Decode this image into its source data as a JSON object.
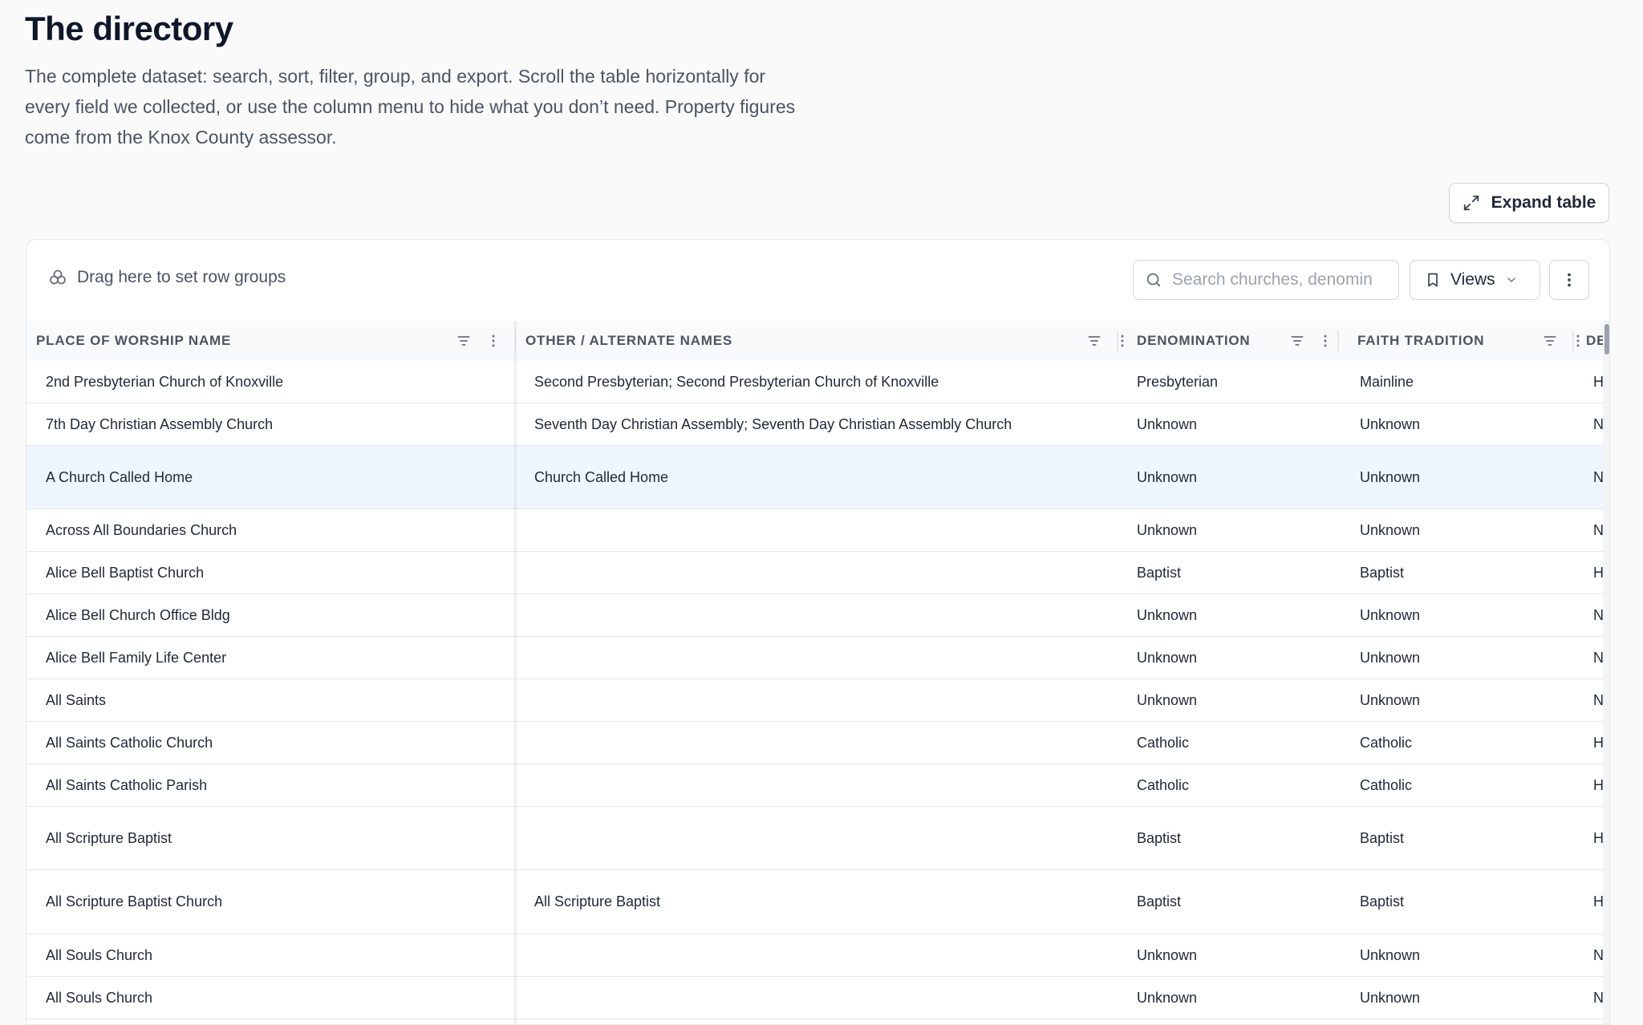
{
  "page": {
    "title": "The directory",
    "description": "The complete dataset: search, sort, filter, group, and export. Scroll the table horizontally for every field we collected, or use the column menu to hide what you don’t need. Property figures come from the Knox County assessor."
  },
  "actions": {
    "expand_label": "Expand table"
  },
  "toolbar": {
    "group_hint": "Drag here to set row groups",
    "search_placeholder": "Search churches, denominations…",
    "views_label": "Views"
  },
  "columns": [
    "PLACE OF WORSHIP NAME",
    "OTHER / ALTERNATE NAMES",
    "DENOMINATION",
    "FAITH TRADITION",
    "DE"
  ],
  "rows": [
    {
      "name": "2nd Presbyterian Church of Knoxville",
      "alt": "Second Presbyterian; Second Presbyterian Church of Knoxville",
      "denom": "Presbyterian",
      "tradition": "Mainline",
      "extra": "H"
    },
    {
      "name": "7th Day Christian Assembly Church",
      "alt": "Seventh Day Christian Assembly; Seventh Day Christian Assembly Church",
      "denom": "Unknown",
      "tradition": "Unknown",
      "extra": "N"
    },
    {
      "name": "A Church Called Home",
      "alt": "Church Called Home",
      "denom": "Unknown",
      "tradition": "Unknown",
      "extra": "N"
    },
    {
      "name": "Across All Boundaries Church",
      "alt": "",
      "denom": "Unknown",
      "tradition": "Unknown",
      "extra": "N"
    },
    {
      "name": "Alice Bell Baptist Church",
      "alt": "",
      "denom": "Baptist",
      "tradition": "Baptist",
      "extra": "H"
    },
    {
      "name": "Alice Bell Church Office Bldg",
      "alt": "",
      "denom": "Unknown",
      "tradition": "Unknown",
      "extra": "N"
    },
    {
      "name": "Alice Bell Family Life Center",
      "alt": "",
      "denom": "Unknown",
      "tradition": "Unknown",
      "extra": "N"
    },
    {
      "name": "All Saints",
      "alt": "",
      "denom": "Unknown",
      "tradition": "Unknown",
      "extra": "N"
    },
    {
      "name": "All Saints Catholic Church",
      "alt": "",
      "denom": "Catholic",
      "tradition": "Catholic",
      "extra": "H"
    },
    {
      "name": "All Saints Catholic Parish",
      "alt": "",
      "denom": "Catholic",
      "tradition": "Catholic",
      "extra": "H"
    },
    {
      "name": "All Scripture Baptist",
      "alt": "",
      "denom": "Baptist",
      "tradition": "Baptist",
      "extra": "H"
    },
    {
      "name": "All Scripture Baptist Church",
      "alt": "All Scripture Baptist",
      "denom": "Baptist",
      "tradition": "Baptist",
      "extra": "H"
    },
    {
      "name": "All Souls Church",
      "alt": "",
      "denom": "Unknown",
      "tradition": "Unknown",
      "extra": "N"
    },
    {
      "name": "All Souls Church",
      "alt": "",
      "denom": "Unknown",
      "tradition": "Unknown",
      "extra": "N"
    }
  ]
}
